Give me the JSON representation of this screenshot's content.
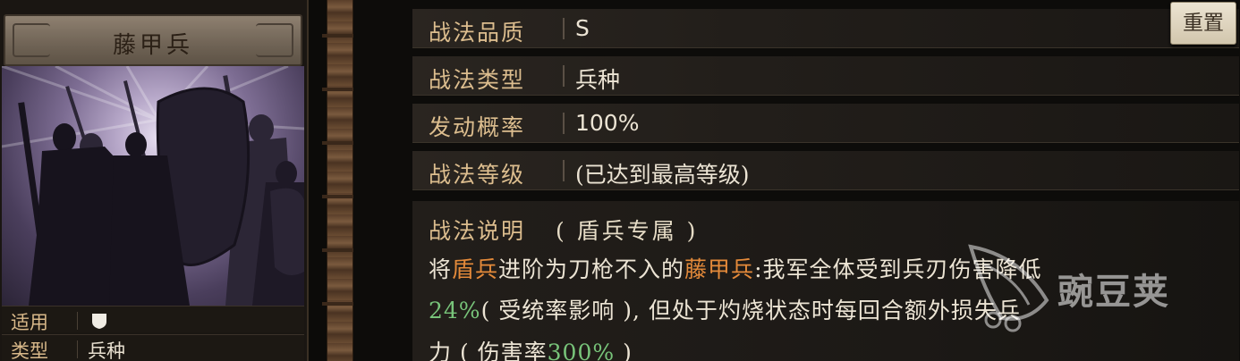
{
  "card": {
    "name": "藤甲兵",
    "apply_label": "适用",
    "type_label": "类型",
    "type_value": "兵种"
  },
  "attributes": [
    {
      "label": "战法品质",
      "value": "S"
    },
    {
      "label": "战法类型",
      "value": "兵种"
    },
    {
      "label": "发动概率",
      "value": "100%"
    },
    {
      "label": "战法等级",
      "value": "(已达到最高等级)"
    }
  ],
  "reset_label": "重置",
  "description": {
    "label": "战法说明",
    "note": "( 盾兵专属 )",
    "line1": [
      {
        "text": "将",
        "c": ""
      },
      {
        "text": "盾兵",
        "c": "orange"
      },
      {
        "text": "进阶为刀枪不入的",
        "c": ""
      },
      {
        "text": "藤甲兵",
        "c": "orange"
      },
      {
        "text": ":我军全体受到兵刃伤害降低",
        "c": ""
      }
    ],
    "line2": [
      {
        "text": "24%",
        "c": "green"
      },
      {
        "text": "( 受统率影响 ), 但处于灼烧状态时每回合额外损失兵",
        "c": ""
      }
    ],
    "line3": [
      {
        "text": "力 ( 伤害率",
        "c": ""
      },
      {
        "text": "300%",
        "c": "green"
      },
      {
        "text": " )",
        "c": ""
      }
    ]
  },
  "watermark": "豌豆荚",
  "colors": {
    "accent_label": "#dcbd8e",
    "highlight_orange": "#e48a3a",
    "highlight_green": "#78c47a"
  }
}
